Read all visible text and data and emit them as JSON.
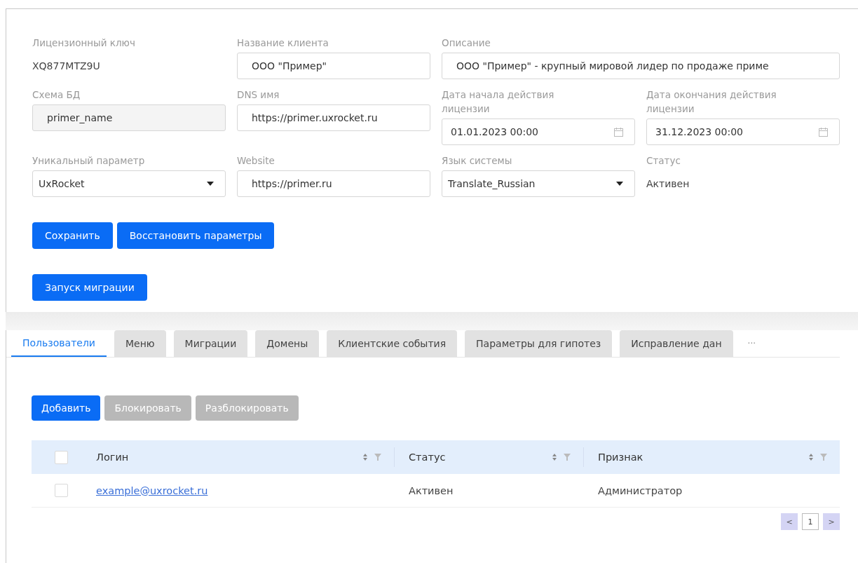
{
  "fields": [
    {
      "label": "Лицензионный ключ",
      "value": "XQ877MTZ9U",
      "kind": "static"
    },
    {
      "label": "Название клиента",
      "value": "ООО \"Пример\"",
      "kind": "text"
    },
    {
      "label": "Описание",
      "value": "ООО \"Пример\" - крупный мировой лидер по продаже приме",
      "kind": "long_text"
    },
    {
      "label": "Схема БД",
      "value": "primer_name",
      "kind": "disabled"
    },
    {
      "label": "DNS имя",
      "value": "https://primer.uxrocket.ru",
      "kind": "text"
    },
    {
      "label": "Дата начала действия лицензии",
      "value": "01.01.2023 00:00",
      "kind": "date"
    },
    {
      "label": "Дата окончания действия лицензии",
      "value": "31.12.2023 00:00",
      "kind": "date"
    },
    {
      "label": "Уникальный параметр",
      "value": "UxRocket",
      "kind": "select"
    },
    {
      "label": "Website",
      "value": "https://primer.ru",
      "kind": "text"
    },
    {
      "label": "Язык системы",
      "value": "Translate_Russian",
      "kind": "select"
    },
    {
      "label": "Статус",
      "value": "Активен",
      "kind": "static"
    }
  ],
  "form_buttons": [
    {
      "label": "Сохранить"
    },
    {
      "label": "Восстановить параметры"
    }
  ],
  "migration_button": {
    "label": "Запуск миграции"
  },
  "tabs": [
    {
      "label": "Пользователи",
      "selected": true
    },
    {
      "label": "Меню",
      "selected": false
    },
    {
      "label": "Миграции",
      "selected": false
    },
    {
      "label": "Домены",
      "selected": false
    },
    {
      "label": "Клиентские события",
      "selected": false
    },
    {
      "label": "Параметры для гипотез",
      "selected": false
    },
    {
      "label": "Исправление дан",
      "selected": false
    }
  ],
  "tabs_more": "···",
  "table_buttons": [
    {
      "label": "Добавить",
      "disabled": false
    },
    {
      "label": "Блокировать",
      "disabled": true
    },
    {
      "label": "Разблокировать",
      "disabled": true
    }
  ],
  "table": {
    "all_checked": false,
    "columns": [
      "Логин",
      "Статус",
      "Признак"
    ],
    "rows": [
      {
        "checked": false,
        "login": "example@uxrocket.ru",
        "status": "Активен",
        "role": "Администратор"
      }
    ]
  },
  "pagination": {
    "prev": "<",
    "pages": [
      {
        "label": "1",
        "selected": true
      }
    ],
    "next": ">"
  }
}
